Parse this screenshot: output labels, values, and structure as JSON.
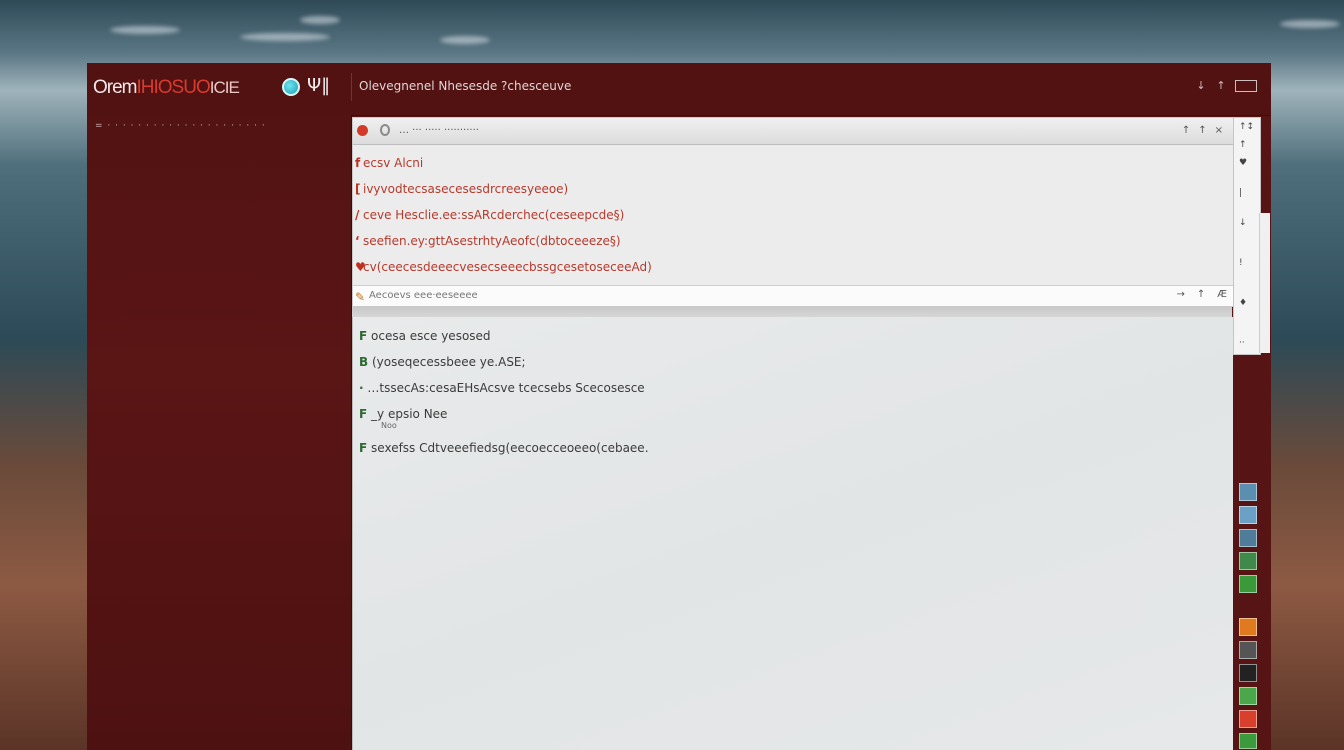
{
  "window": {
    "logo_prefix": "Orem",
    "logo_red": "IHIOSUO",
    "logo_tail": "ICIE",
    "toolbar_glyph": "Ψ‖",
    "title": "Olevegnenel Nhesesde ?chesceuve",
    "controls": [
      "↓",
      "↑",
      ""
    ]
  },
  "sidebar": {
    "label": "= · · · · · · · · · · · · · · · · · · · · ·"
  },
  "editor": {
    "tab_label": "… ··· ····· ···········",
    "tab_controls": [
      "↑",
      "↑",
      "×"
    ],
    "lines": [
      {
        "gutter": "f",
        "text": "ecsv  Alcni"
      },
      {
        "gutter": "[",
        "text": "ivyvodtecsasecesesdrcreesyeeoe)"
      },
      {
        "gutter": "/",
        "text": "ceve  Hesclie.ee:ssARcderchec(ceseepcde§)"
      },
      {
        "gutter": "‘",
        "text": "seefien.ey:gttAsestrhtyAeofc(dbtoceeeze§)"
      },
      {
        "gutter": "♥",
        "text": "cv(ceecesdeeecvesecseeecbssgcesetoseceeAd)"
      }
    ],
    "status_label": "Aecoevs eee·eeseeee",
    "status_controls": [
      "→",
      "↑",
      "Æ"
    ]
  },
  "output": {
    "lines": [
      {
        "mark": "F",
        "text": "ocesa esce  yesosed"
      },
      {
        "mark": "B",
        "text": "(yoseqecessbeee ye.ASE;"
      },
      {
        "mark": "·",
        "text": "…tssecAs:cesaEHsAcsve  tcecsebs  Scecosesce"
      },
      {
        "mark": "F",
        "text": "_y  epsio  Nee"
      },
      {
        "mark": "F",
        "text": "sexefss Cdtveeefiedsg(eecoecceoeeo(cebaee."
      }
    ],
    "sub_note": "Noo"
  },
  "right_panel": {
    "glyphs": [
      "↑↕",
      "↑",
      "♥",
      "|",
      "↓",
      "!",
      "♦",
      "··"
    ]
  },
  "colors": {
    "window_bg": "#561414",
    "accent_red": "#d83a2e",
    "code_red": "#b63a2c",
    "mark_green": "#2d6a33"
  },
  "dock_icons": [
    "monitor-icon",
    "image-icon",
    "folder-icon",
    "chart-icon",
    "rss-icon",
    "app-icon",
    "terminal-icon",
    "people-icon",
    "media-icon",
    "leaf-icon"
  ]
}
